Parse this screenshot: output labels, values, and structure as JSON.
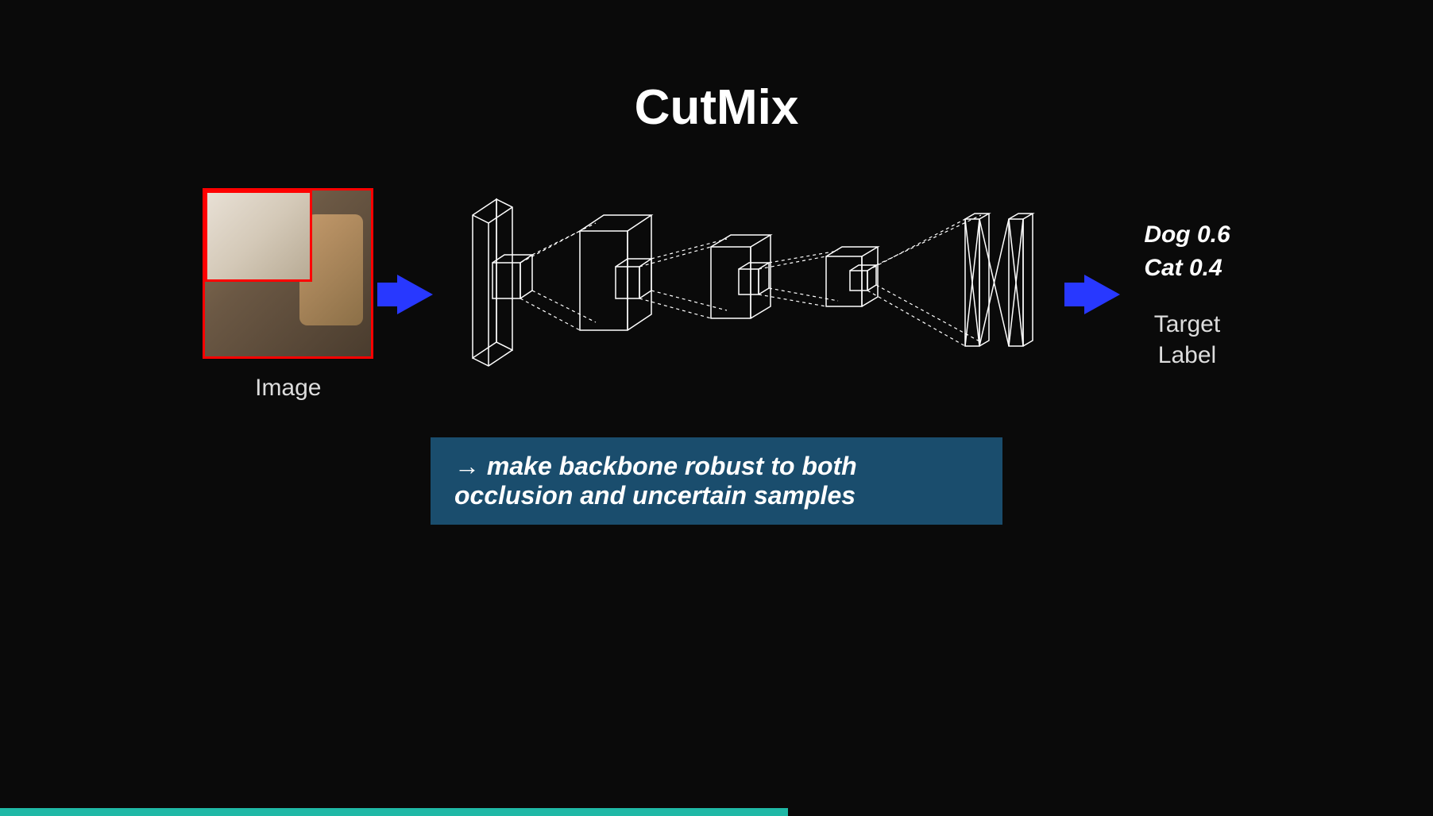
{
  "title": "CutMix",
  "image_label": "Image",
  "output": {
    "line1": "Dog 0.6",
    "line2": "Cat 0.4"
  },
  "target_label_line1": "Target",
  "target_label_line2": "Label",
  "caption": "→  make backbone robust to both occlusion and uncertain samples",
  "progress_percent": 55
}
